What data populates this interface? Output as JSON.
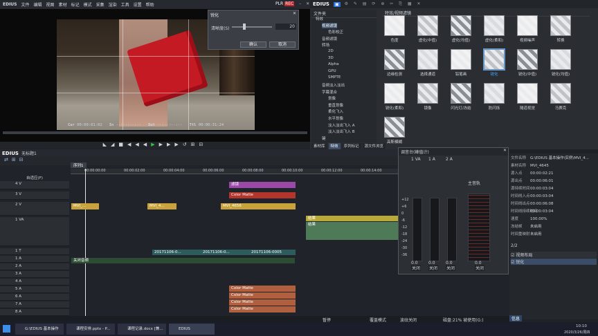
{
  "app": {
    "logo": "EDIUS",
    "menu": [
      "文件",
      "编辑",
      "视图",
      "素材",
      "标记",
      "模式",
      "采集",
      "渲染",
      "工具",
      "设置",
      "帮助"
    ],
    "plr": "PLR",
    "rec": "REC"
  },
  "dialog": {
    "title": "锐化",
    "param_label": "清晰度(S)",
    "param_value": "20",
    "ok": "确认",
    "cancel": "取消"
  },
  "preview": {
    "cur_label": "Cur",
    "cur": "00:00:01:02",
    "in_label": "In",
    "in": "--:--:--:--",
    "out_label": "Out",
    "out": "--:--:--:--",
    "ttl_label": "Ttl",
    "ttl": "00:00:31:24"
  },
  "right_panel": {
    "title": "EDIUS",
    "tree_header": "文件夹",
    "effects_header": "特效/视频滤镜",
    "tree": [
      {
        "label": "特效",
        "indent": 0
      },
      {
        "label": "视频滤镜",
        "indent": 1,
        "selected": true
      },
      {
        "label": "色彩校正",
        "indent": 2
      },
      {
        "label": "音频滤镜",
        "indent": 1
      },
      {
        "label": "转场",
        "indent": 1
      },
      {
        "label": "2D",
        "indent": 2
      },
      {
        "label": "3D",
        "indent": 2
      },
      {
        "label": "Alpha",
        "indent": 2
      },
      {
        "label": "GPU",
        "indent": 2
      },
      {
        "label": "SMPTE",
        "indent": 2
      },
      {
        "label": "音频淡入淡出",
        "indent": 1
      },
      {
        "label": "字幕混合",
        "indent": 1
      },
      {
        "label": "划像",
        "indent": 2
      },
      {
        "label": "垂直划像",
        "indent": 2
      },
      {
        "label": "柔化飞入",
        "indent": 2
      },
      {
        "label": "水平划像",
        "indent": 2
      },
      {
        "label": "淡入淡出飞入 A",
        "indent": 2
      },
      {
        "label": "淡入淡出飞入 B",
        "indent": 2
      },
      {
        "label": "键",
        "indent": 1
      }
    ],
    "tabs": [
      "素材库",
      "特效",
      "序列标记",
      "源文件浏览"
    ],
    "effects": [
      {
        "label": "色度",
        "icon": "chroma-icon"
      },
      {
        "label": "虚化(中值)",
        "icon": "blur-median-icon"
      },
      {
        "label": "虚化(均值)",
        "icon": "blur-mean-icon"
      },
      {
        "label": "虚化(柔和)",
        "icon": "blur-soft-icon"
      },
      {
        "label": "视频噪声",
        "icon": "noise-icon"
      },
      {
        "label": "转换",
        "icon": "transform-icon"
      },
      {
        "label": "边缘检测",
        "icon": "edge-icon"
      },
      {
        "label": "选择通道",
        "icon": "channel-icon"
      },
      {
        "label": "铅笔画",
        "icon": "pencil-icon"
      },
      {
        "label": "锐化",
        "icon": "sharpen-icon",
        "selected": true
      },
      {
        "label": "锐化(中值)",
        "icon": "sharpen-median-icon"
      },
      {
        "label": "锐化(均值)",
        "icon": "sharpen-mean-icon"
      },
      {
        "label": "锐化(柔和)",
        "icon": "sharpen-soft-icon"
      },
      {
        "label": "镜像",
        "icon": "mirror-icon"
      },
      {
        "label": "闪光灯/冻结",
        "icon": "strobe-icon"
      },
      {
        "label": "防闪烁",
        "icon": "flicker-icon"
      },
      {
        "label": "隧道视觉",
        "icon": "tunnel-icon"
      },
      {
        "label": "马赛克",
        "icon": "mosaic-icon"
      },
      {
        "label": "高斯模糊",
        "icon": "gauss-icon"
      }
    ]
  },
  "timeline": {
    "logo": "EDIUS",
    "project": "无标题1",
    "sequence_tab": "序列1",
    "mode": "自适应(F)",
    "ruler": [
      "00:00:00:00",
      "00:00:02:00",
      "00:00:04:00",
      "00:00:06:00",
      "00:00:08:00",
      "00:00:10:00",
      "00:00:12:00",
      "00:00:14:00",
      "00:00:16:00"
    ],
    "tracks": [
      "4 V",
      "3 V",
      "2 V",
      "1 VA",
      "1 T",
      "1 A",
      "2 A",
      "3 A",
      "4 A",
      "5 A",
      "6 A",
      "7 A",
      "8 A"
    ],
    "clips": {
      "v4": "滤镜",
      "v3": "Color Matte",
      "v2": [
        "MVI_...",
        "MVI_4...",
        "MVI_4656"
      ],
      "va": "结果",
      "va2": "结果",
      "t": [
        "20171106-0...",
        "20171106-0...",
        "20171106-0005"
      ],
      "a1": "关闭音频",
      "a": [
        "Color Matte",
        "Color Matte",
        "Color Matte",
        "Color Matte"
      ]
    }
  },
  "mixer": {
    "title": "调音台(峰值计)",
    "channels": [
      "1 VA",
      "1 A",
      "2 A",
      "主音轨"
    ],
    "vals": [
      "0.0",
      "0.0",
      "0.0",
      "0.0"
    ],
    "offs": [
      "关闭",
      "关闭",
      "关闭",
      "关闭"
    ],
    "scale": [
      "+12",
      "+6",
      "0",
      "-6",
      "-12",
      "-18",
      "-24",
      "-30",
      "-36"
    ]
  },
  "info": {
    "rows": [
      {
        "k": "文件名称",
        "v": "G:\\EDIUS 基本操作\\实例\\MVI_4..."
      },
      {
        "k": "素材名称",
        "v": "MVI_4645"
      },
      {
        "k": "源入点",
        "v": "00:00:02:21"
      },
      {
        "k": "源出点",
        "v": "00:00:06:01"
      },
      {
        "k": "源持续时间",
        "v": "00:00:03:04"
      },
      {
        "k": "时间线入点",
        "v": "00:00:03:04"
      },
      {
        "k": "时间线出点",
        "v": "00:00:06:08"
      },
      {
        "k": "时间线持续时间",
        "v": "00:00:03:04"
      },
      {
        "k": "速度",
        "v": "100.00%"
      },
      {
        "k": "冻结帧",
        "v": "未启用"
      },
      {
        "k": "时间重映射",
        "v": "未启用"
      }
    ],
    "count": "2/2",
    "filters": [
      "视频布局",
      "锐化"
    ],
    "footer": "信息"
  },
  "status": {
    "pause": "暂停",
    "overwrite": "覆盖模式",
    "ripple": "波纹关闭",
    "disk": "磁盘:21% 被使用(G:)"
  },
  "taskbar": {
    "items": [
      "G:\\EDIUS 基本操作",
      "课程安排.pptx - P...",
      "课程记录.docx [兼...",
      "EDIUS"
    ],
    "time": "10:10",
    "date": "2020/3/26/周四"
  }
}
